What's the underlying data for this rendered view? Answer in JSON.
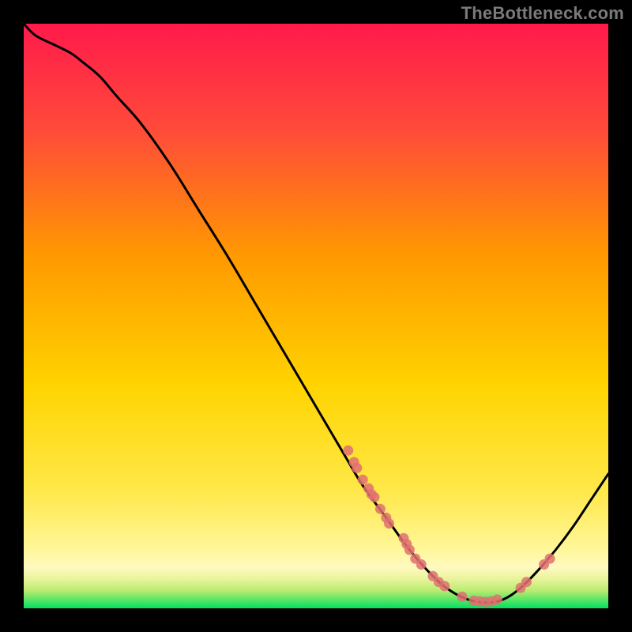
{
  "watermark": "TheBottleneck.com",
  "chart_data": {
    "type": "line",
    "title": "",
    "xlabel": "",
    "ylabel": "",
    "xlim": [
      0,
      100
    ],
    "ylim": [
      0,
      100
    ],
    "grid": false,
    "legend": false,
    "background_gradient": {
      "top": "#ff1a4b",
      "mid1": "#ff9a00",
      "mid2": "#ffe400",
      "near_bottom": "#fff89a",
      "bottom_band1": "#d7f08a",
      "bottom_band2": "#00e060"
    },
    "series": [
      {
        "name": "curve",
        "stroke": "#000000",
        "x": [
          0,
          2,
          5,
          8,
          10,
          13,
          16,
          20,
          25,
          30,
          35,
          40,
          45,
          50,
          55,
          58,
          62,
          66,
          70,
          73,
          76,
          79,
          82,
          85,
          88,
          91,
          94,
          97,
          100
        ],
        "y": [
          100,
          98,
          96.5,
          95,
          93.5,
          91,
          87.5,
          83,
          76,
          68,
          60,
          51.5,
          43,
          34.5,
          26,
          21,
          15.5,
          10,
          5.5,
          3,
          1.5,
          1,
          1.5,
          3.5,
          6.5,
          10,
          14,
          18.5,
          23
        ]
      },
      {
        "name": "points-left",
        "marker": "circle",
        "color": "#e07070",
        "x": [
          55.5,
          56.5,
          57,
          58,
          59,
          59.5,
          60,
          61,
          62,
          62.5,
          65,
          65.5,
          66,
          67,
          68,
          70,
          71,
          72,
          75
        ],
        "y": [
          27,
          25,
          24,
          22,
          20.5,
          19.5,
          19,
          17,
          15.5,
          14.5,
          12,
          11,
          10,
          8.5,
          7.5,
          5.5,
          4.5,
          3.8,
          2
        ]
      },
      {
        "name": "points-right",
        "marker": "circle",
        "color": "#e07070",
        "x": [
          77,
          78,
          79,
          80,
          81,
          85,
          86,
          89,
          90
        ],
        "y": [
          1.3,
          1.2,
          1.1,
          1.2,
          1.5,
          3.5,
          4.5,
          7.5,
          8.5
        ]
      }
    ]
  }
}
